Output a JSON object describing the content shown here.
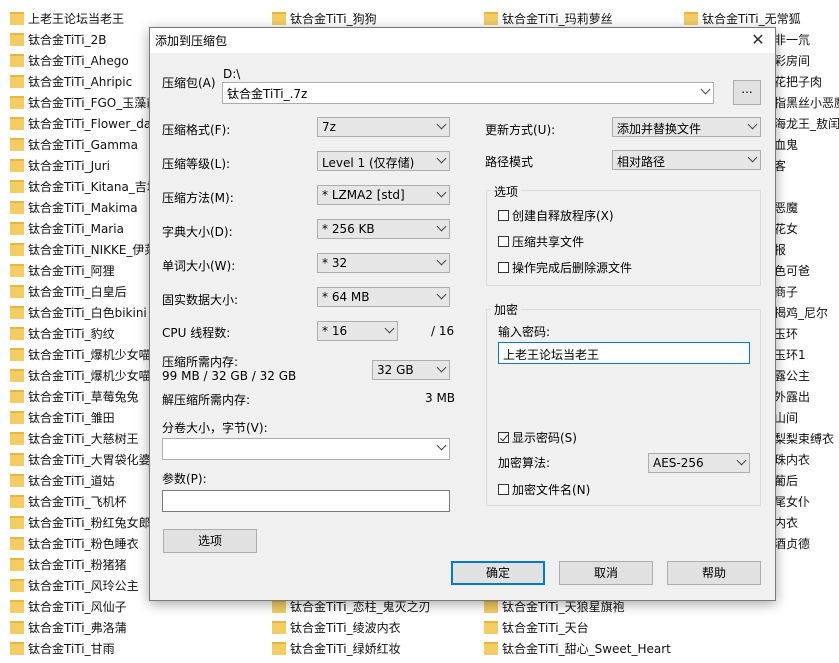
{
  "background": {
    "col1": [
      "上老王论坛当老王",
      "钛合金TiTi_2B",
      "钛合金TiTi_Ahego",
      "钛合金TiTi_Ahripic",
      "钛合金TiTi_FGO_玉藻前",
      "钛合金TiTi_Flower_dance",
      "钛合金TiTi_Gamma",
      "钛合金TiTi_Juri",
      "钛合金TiTi_Kitana_吉塔娜",
      "钛合金TiTi_Makima",
      "钛合金TiTi_Maria",
      "钛合金TiTi_NIKKE_伊莱格",
      "钛合金TiTi_阿狸",
      "钛合金TiTi_白皇后",
      "钛合金TiTi_白色bikini",
      "钛合金TiTi_豹纹",
      "钛合金TiTi_爆机少女喵小吉",
      "钛合金TiTi_爆机少女喵小吉",
      "钛合金TiTi_草莓兔兔",
      "钛合金TiTi_雏田",
      "钛合金TiTi_大慈树王",
      "钛合金TiTi_大胃袋化婆鼎",
      "钛合金TiTi_道姑",
      "钛合金TiTi_飞机杯",
      "钛合金TiTi_粉红兔女郎",
      "钛合金TiTi_粉色睡衣",
      "钛合金TiTi_粉猪猪",
      "钛合金TiTi_风玲公主",
      "钛合金TiTi_风仙子",
      "钛合金TiTi_弗洛蒲",
      "钛合金TiTi_甘雨"
    ],
    "top_row": [
      "钛合金TiTi_狗狗",
      "钛合金TiTi_玛莉萝丝",
      "钛合金TiTi_无常狐"
    ],
    "col4": [
      "非一氘",
      "彩房间",
      "花把子肉",
      "指黑丝小恶魔",
      "海龙王_敖闰",
      "血鬼",
      "客",
      "",
      "恶魔",
      "花女",
      "报",
      "色可爸",
      "商子",
      "揭鸡_尼尔",
      "玉环",
      "玉环1",
      "露公主",
      "外露出",
      "山间",
      "梨梨束缚衣",
      "珠内衣",
      "葡后",
      "尾女仆",
      "内衣",
      "酒贞德"
    ],
    "bottom_col2": [
      "钛合金TiTi_恋柱_鬼灭之刃",
      "钛合金TiTi_绫波内衣",
      "钛合金TiTi_绿娇红妆"
    ],
    "bottom_col3": [
      "钛合金TiTi_天狼星旗袍",
      "钛合金TiTi_天台",
      "钛合金TiTi_甜心_Sweet_Heart"
    ]
  },
  "dialog": {
    "title": "添加到压缩包",
    "close": "✕",
    "archive_label": "压缩包(A)",
    "archive_path": "D:\\",
    "archive_name": "钛合金TiTi_.7z",
    "browse": "...",
    "format_label": "压缩格式(F):",
    "format_value": "7z",
    "level_label": "压缩等级(L):",
    "level_value": "Level 1 (仅存储)",
    "method_label": "压缩方法(M):",
    "method_value": "* LZMA2 [std]",
    "dict_label": "字典大小(D):",
    "dict_value": "* 256 KB",
    "word_label": "单词大小(W):",
    "word_value": "* 32",
    "solid_label": "固实数据大小:",
    "solid_value": "* 64 MB",
    "cpu_label": "CPU 线程数:",
    "cpu_value": "* 16",
    "cpu_total": "/ 16",
    "mem_label": "压缩所需内存:",
    "mem_detail": "99 MB / 32 GB / 32 GB",
    "mem_value": "32 GB",
    "decomp_label": "解压缩所需内存:",
    "decomp_value": "3 MB",
    "split_label": "分卷大小，字节(V):",
    "split_value": "",
    "params_label": "参数(P):",
    "params_value": "",
    "options_button": "选项",
    "update_label": "更新方式(U):",
    "update_value": "添加并替换文件",
    "path_label": "路径模式",
    "path_value": "相对路径",
    "options_group": "选项",
    "opt_sfx": "创建自释放程序(X)",
    "opt_shared": "压缩共享文件",
    "opt_delete": "操作完成后删除源文件",
    "encrypt_group": "加密",
    "password_label": "输入密码:",
    "password_value": "上老王论坛当老王",
    "show_password": "显示密码(S)",
    "enc_method_label": "加密算法:",
    "enc_method_value": "AES-256",
    "enc_filenames": "加密文件名(N)",
    "ok": "确定",
    "cancel": "取消",
    "help": "帮助"
  }
}
